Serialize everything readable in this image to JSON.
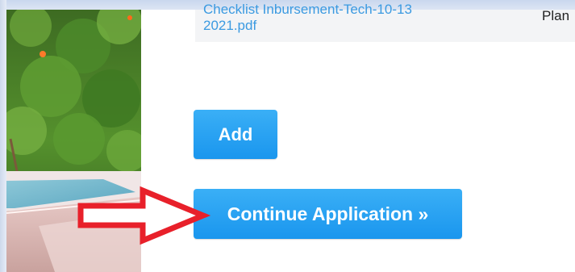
{
  "documents": [
    {
      "file_name_line1": "Checklist Inbursement-Tech-10-13",
      "file_name_line2": "2021.pdf",
      "type": "Plan"
    }
  ],
  "actions": {
    "add_label": "Add",
    "continue_label": "Continue Application »"
  },
  "colors": {
    "button_blue": "#2aa4f4",
    "link_blue": "#3b9ae1",
    "annotation_arrow": "#e8202a"
  }
}
